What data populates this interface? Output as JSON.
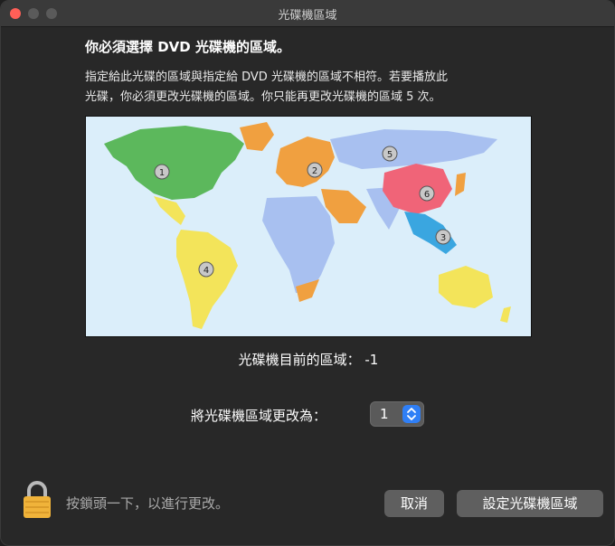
{
  "window": {
    "title": "光碟機區域"
  },
  "heading": "你必須選擇 DVD 光碟機的區域。",
  "description_lines": [
    "指定給此光碟的區域與指定給 DVD 光碟機的區域不相符。若要播放此",
    "光碟，你必須更改光碟機的區域。你只能再更改光碟機的區域 5 次。"
  ],
  "map": {
    "regions": [
      {
        "number": "1",
        "color": "#5cb85c"
      },
      {
        "number": "2",
        "color": "#f0a040"
      },
      {
        "number": "3",
        "color": "#3aa6e0"
      },
      {
        "number": "4",
        "color": "#f3e45a"
      },
      {
        "number": "5",
        "color": "#a8c0f0"
      },
      {
        "number": "6",
        "color": "#f06478"
      }
    ]
  },
  "current_region": {
    "text": "光碟機目前的區域：  -1"
  },
  "change_region": {
    "label": "將光碟機區域更改為：",
    "value": "1"
  },
  "lock": {
    "icon": "lock-icon",
    "text": "按鎖頭一下，以進行更改。"
  },
  "buttons": {
    "cancel": "取消",
    "set": "設定光碟機區域"
  }
}
